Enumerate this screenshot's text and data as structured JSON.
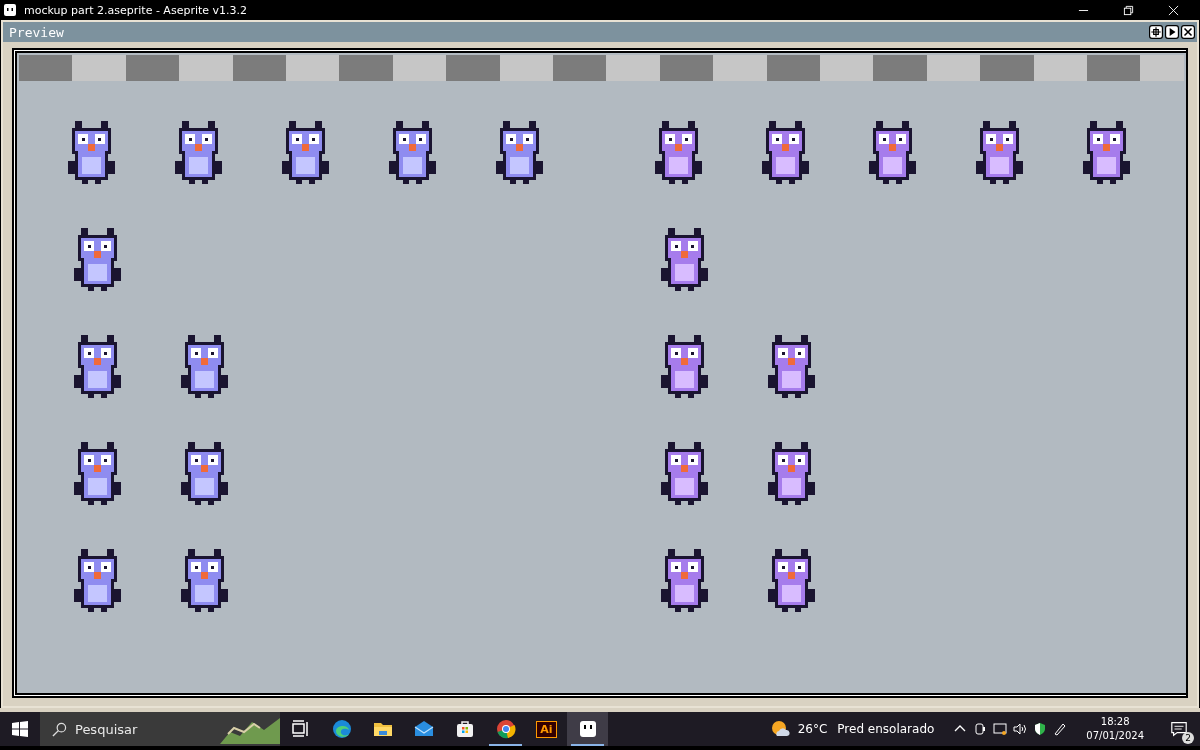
{
  "window": {
    "title": "mockup part 2.aseprite - Aseprite v1.3.2"
  },
  "preview": {
    "title": "Preview"
  },
  "taskbar": {
    "search": {
      "placeholder": "Pesquisar"
    },
    "apps": [
      {
        "kind": "taskview",
        "running": false,
        "selected": false
      },
      {
        "kind": "edge",
        "running": false,
        "selected": false
      },
      {
        "kind": "folder",
        "running": false,
        "selected": false
      },
      {
        "kind": "mail",
        "running": false,
        "selected": false
      },
      {
        "kind": "store",
        "running": false,
        "selected": false
      },
      {
        "kind": "chrome",
        "running": true,
        "selected": false
      },
      {
        "kind": "illustrator",
        "label": "Ai",
        "running": false,
        "selected": false
      },
      {
        "kind": "aseprite",
        "running": true,
        "selected": true
      }
    ],
    "weather": {
      "temperature": "26°C",
      "condition": "Pred ensolarado"
    },
    "clock": {
      "time": "18:28",
      "date": "07/01/2024"
    },
    "notifications": {
      "count": "2"
    }
  }
}
